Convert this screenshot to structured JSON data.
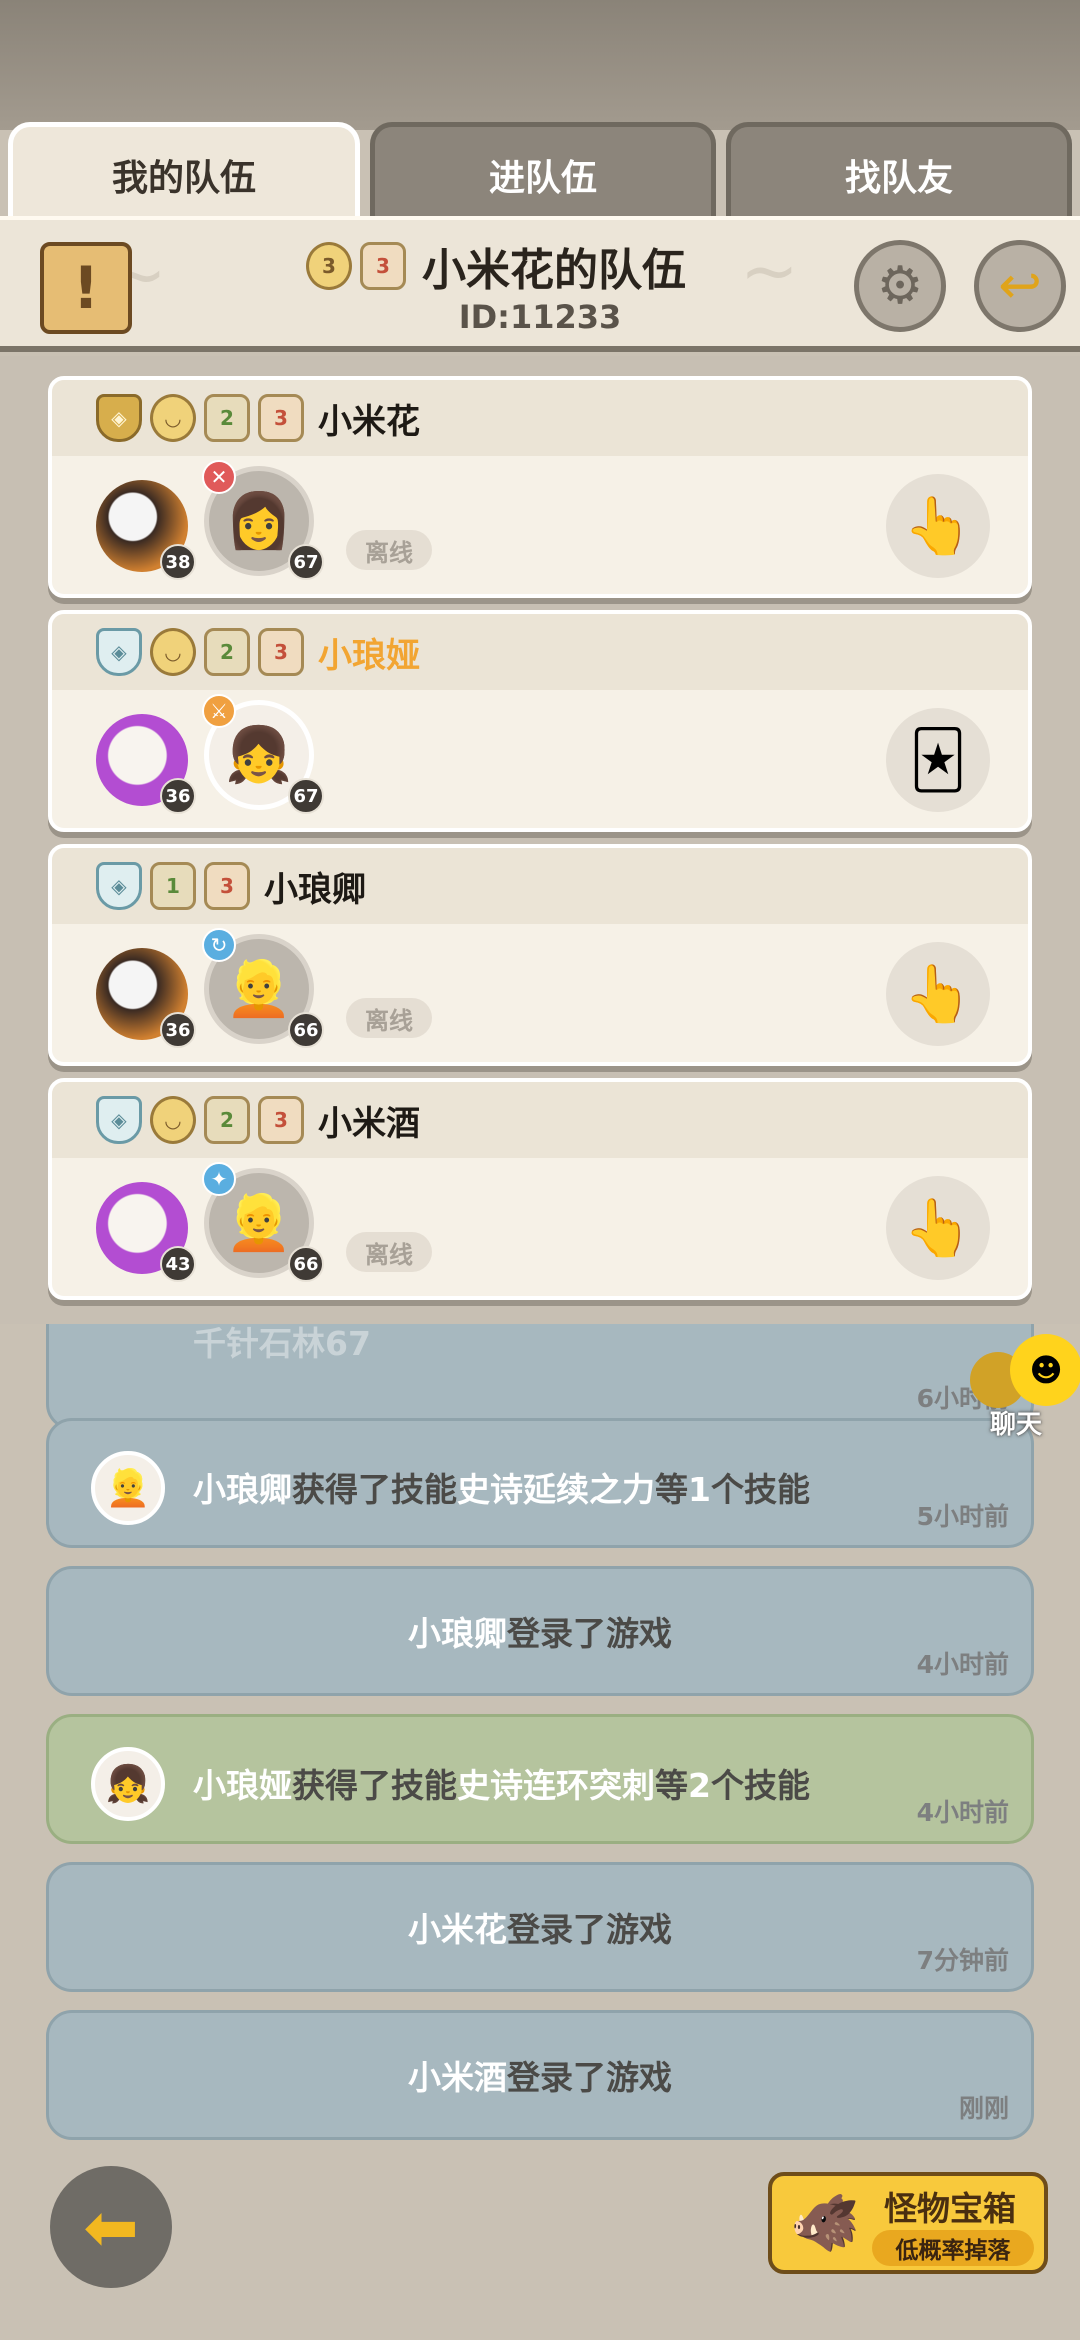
{
  "tabs": [
    {
      "label": "我的队伍",
      "active": true
    },
    {
      "label": "进队伍",
      "active": false
    },
    {
      "label": "找队友",
      "active": false
    }
  ],
  "header": {
    "notice_icon": "exclamation-icon",
    "badge_1": "3",
    "badge_2": "3",
    "team_name": "小米花的队伍",
    "team_id": "ID:11233",
    "settings_icon": "gear-icon",
    "exit_icon": "exit-team-icon"
  },
  "members": [
    {
      "name": "小米花",
      "badges": [
        "",
        "",
        "2",
        "3"
      ],
      "pet_level": "38",
      "char_level": "67",
      "status": "离线",
      "action_icon": "like-hand-icon"
    },
    {
      "name": "小琅娅",
      "name_color": "#f2a532",
      "badges": [
        "",
        "",
        "2",
        "3"
      ],
      "pet_level": "36",
      "char_level": "67",
      "action_icon": "card-hand-icon"
    },
    {
      "name": "小琅卿",
      "badges": [
        "",
        "1",
        "3"
      ],
      "pet_level": "36",
      "char_level": "66",
      "status": "离线",
      "action_icon": "like-hand-icon"
    },
    {
      "name": "小米酒",
      "badges": [
        "",
        "",
        "2",
        "3"
      ],
      "pet_level": "43",
      "char_level": "66",
      "status": "离线",
      "action_icon": "like-hand-icon"
    }
  ],
  "feed": [
    {
      "text_partial": "千针石林67",
      "time": "6小时前"
    },
    {
      "name": "小琅卿",
      "pre": "获得了技能",
      "skill": "史诗延续之力",
      "mid": "等",
      "count": "1",
      "post": "个技能",
      "time": "5小时前"
    },
    {
      "name": "小琅卿",
      "action": "登录了游戏",
      "time": "4小时前"
    },
    {
      "name": "小琅娅",
      "pre": "获得了技能",
      "skill": "史诗连环突刺",
      "mid": "等",
      "count": "2",
      "post": "个技能",
      "time": "4小时前"
    },
    {
      "name": "小米花",
      "action": "登录了游戏",
      "time": "7分钟前"
    },
    {
      "name": "小米酒",
      "action": "登录了游戏",
      "time": "刚刚"
    }
  ],
  "chat": {
    "label": "聊天"
  },
  "back_icon": "back-arrow-icon",
  "chest": {
    "title": "怪物宝箱",
    "subtitle": "低概率掉落"
  },
  "colors": {
    "accent": "#f2a532",
    "feed_blue": "#a7b8bf",
    "feed_green": "#b5c49e",
    "chest": "#f8c93c"
  }
}
